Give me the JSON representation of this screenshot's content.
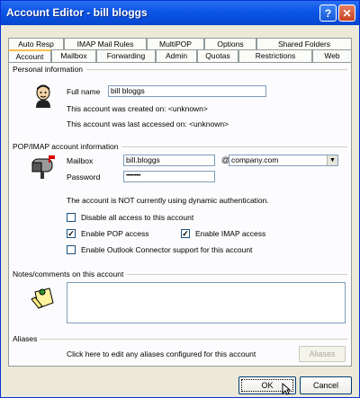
{
  "window": {
    "title": "Account Editor - bill bloggs"
  },
  "tabs": {
    "row1": [
      "Auto Resp",
      "IMAP Mail Rules",
      "MultiPOP",
      "Options",
      "Shared Folders"
    ],
    "row2": [
      "Account",
      "Mailbox",
      "Forwarding",
      "Admin",
      "Quotas",
      "Restrictions",
      "Web"
    ],
    "active": "Account"
  },
  "personal": {
    "section_title": "Personal information",
    "full_name_label": "Full name",
    "full_name_value": "bill bloggs",
    "created_text": "This account was created on: <unknown>",
    "accessed_text": "This account was last accessed on: <unknown>"
  },
  "popimap": {
    "section_title": "POP/IMAP account information",
    "mailbox_label": "Mailbox",
    "mailbox_value": "bill.bloggs",
    "at_sign": "@",
    "domain_value": "company.com",
    "password_label": "Password",
    "password_value": "••••••••••",
    "dynamic_auth_text": "The account is NOT currently using dynamic authentication.",
    "disable_all_label": "Disable all access to this account",
    "disable_all_checked": false,
    "enable_pop_label": "Enable POP access",
    "enable_pop_checked": true,
    "enable_imap_label": "Enable IMAP access",
    "enable_imap_checked": true,
    "enable_outlook_label": "Enable Outlook Connector support for this account",
    "enable_outlook_checked": false
  },
  "notes": {
    "section_title": "Notes/comments on this account",
    "value": ""
  },
  "aliases": {
    "section_title": "Aliases",
    "description": "Click here to edit any aliases configured for this account",
    "button_label": "Aliases"
  },
  "footer": {
    "ok_label": "OK",
    "cancel_label": "Cancel"
  }
}
